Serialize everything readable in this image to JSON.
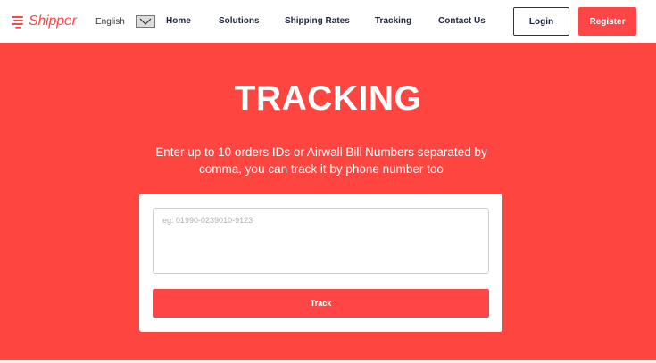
{
  "brand": {
    "name": "Shipper",
    "color": "#ff4545",
    "logo_icon": "shipper-lines-icon"
  },
  "language": {
    "selected": "English",
    "dropdown_icon": "chevron-down-icon"
  },
  "nav": {
    "items": [
      {
        "label": "Home"
      },
      {
        "label": "Solutions"
      },
      {
        "label": "Shipping Rates"
      },
      {
        "label": "Tracking"
      },
      {
        "label": "Contact Us"
      }
    ],
    "login_label": "Login",
    "register_label": "Register"
  },
  "hero": {
    "title": "TRACKING",
    "description": "Enter up to 10 orders IDs or Airwall Bill Numbers separated by comma, you can track it by phone number too",
    "background": "#ff4540"
  },
  "tracking": {
    "input_value": "",
    "input_placeholder": "eg: 01990-0239010-9123",
    "track_label": "Track"
  }
}
